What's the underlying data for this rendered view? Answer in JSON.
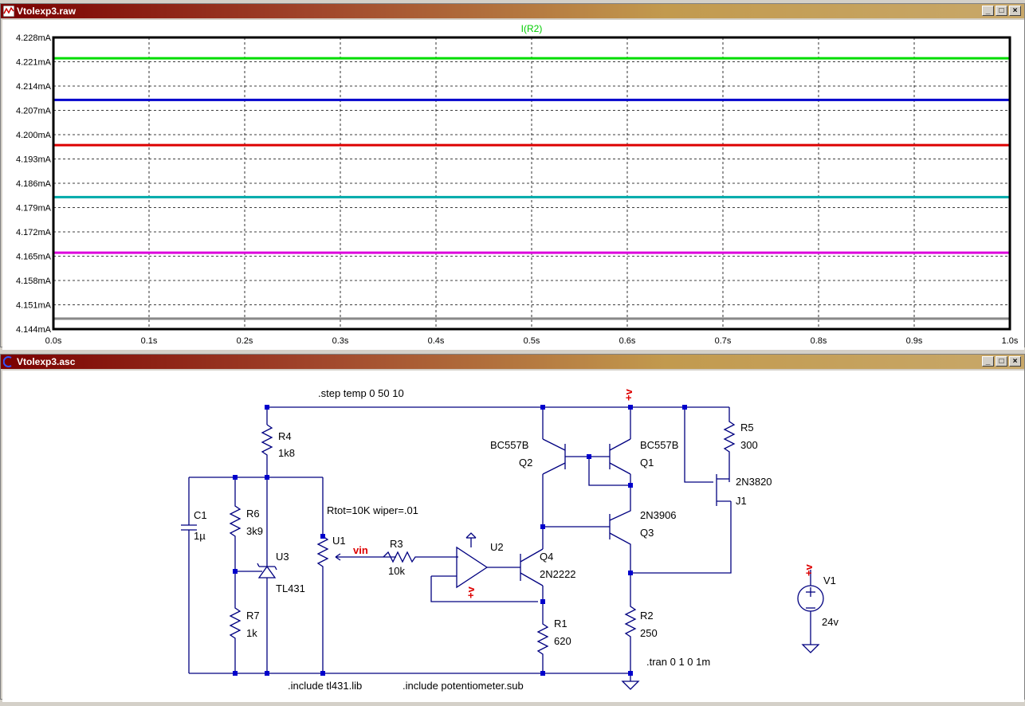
{
  "waveform_window": {
    "title": "Vtolexp3.raw",
    "trace_label": "I(R2)",
    "controls": {
      "minimize": "_",
      "maximize": "□",
      "close": "×"
    }
  },
  "chart_data": {
    "type": "line",
    "title": "I(R2)",
    "xlim": [
      0.0,
      1.0
    ],
    "ylim": [
      4.144,
      4.228
    ],
    "x_ticks": [
      "0.0s",
      "0.1s",
      "0.2s",
      "0.3s",
      "0.4s",
      "0.5s",
      "0.6s",
      "0.7s",
      "0.8s",
      "0.9s",
      "1.0s"
    ],
    "y_ticks": [
      "4.228mA",
      "4.221mA",
      "4.214mA",
      "4.207mA",
      "4.200mA",
      "4.193mA",
      "4.186mA",
      "4.179mA",
      "4.172mA",
      "4.165mA",
      "4.158mA",
      "4.151mA",
      "4.144mA"
    ],
    "grid": true,
    "series": [
      {
        "color": "#00dd00",
        "values": [
          4.222,
          4.222
        ]
      },
      {
        "color": "#0000cc",
        "values": [
          4.21,
          4.21
        ]
      },
      {
        "color": "#dd0000",
        "values": [
          4.197,
          4.197
        ]
      },
      {
        "color": "#00aaaa",
        "values": [
          4.182,
          4.182
        ]
      },
      {
        "color": "#dd00dd",
        "values": [
          4.166,
          4.166
        ]
      },
      {
        "color": "#888888",
        "values": [
          4.147,
          4.147
        ]
      }
    ],
    "x": [
      0.0,
      1.0
    ]
  },
  "schematic_window": {
    "title": "Vtolexp3.asc",
    "controls": {
      "minimize": "_",
      "maximize": "□",
      "close": "×"
    },
    "directives": {
      "step": ".step temp 0 50 10",
      "tran": ".tran 0 1 0 1m",
      "inc1": ".include tl431.lib",
      "inc2": ".include potentiometer.sub",
      "pot": "Rtot=10K wiper=.01"
    },
    "labels": {
      "vplus": "+v",
      "vin": "vin",
      "R4": "R4",
      "R4v": "1k8",
      "C1": "C1",
      "C1v": "1µ",
      "R6": "R6",
      "R6v": "3k9",
      "U3": "U3",
      "U3v": "TL431",
      "R7": "R7",
      "R7v": "1k",
      "U1": "U1",
      "R3": "R3",
      "R3v": "10k",
      "U2": "U2",
      "Q4": "Q4",
      "Q4v": "2N2222",
      "R1": "R1",
      "R1v": "620",
      "Q2v": "BC557B",
      "Q2": "Q2",
      "Q1v": "BC557B",
      "Q1": "Q1",
      "Q3v": "2N3906",
      "Q3": "Q3",
      "R2": "R2",
      "R2v": "250",
      "R5": "R5",
      "R5v": "300",
      "J1v": "2N3820",
      "J1": "J1",
      "V1": "V1",
      "V1v": "24v"
    }
  }
}
